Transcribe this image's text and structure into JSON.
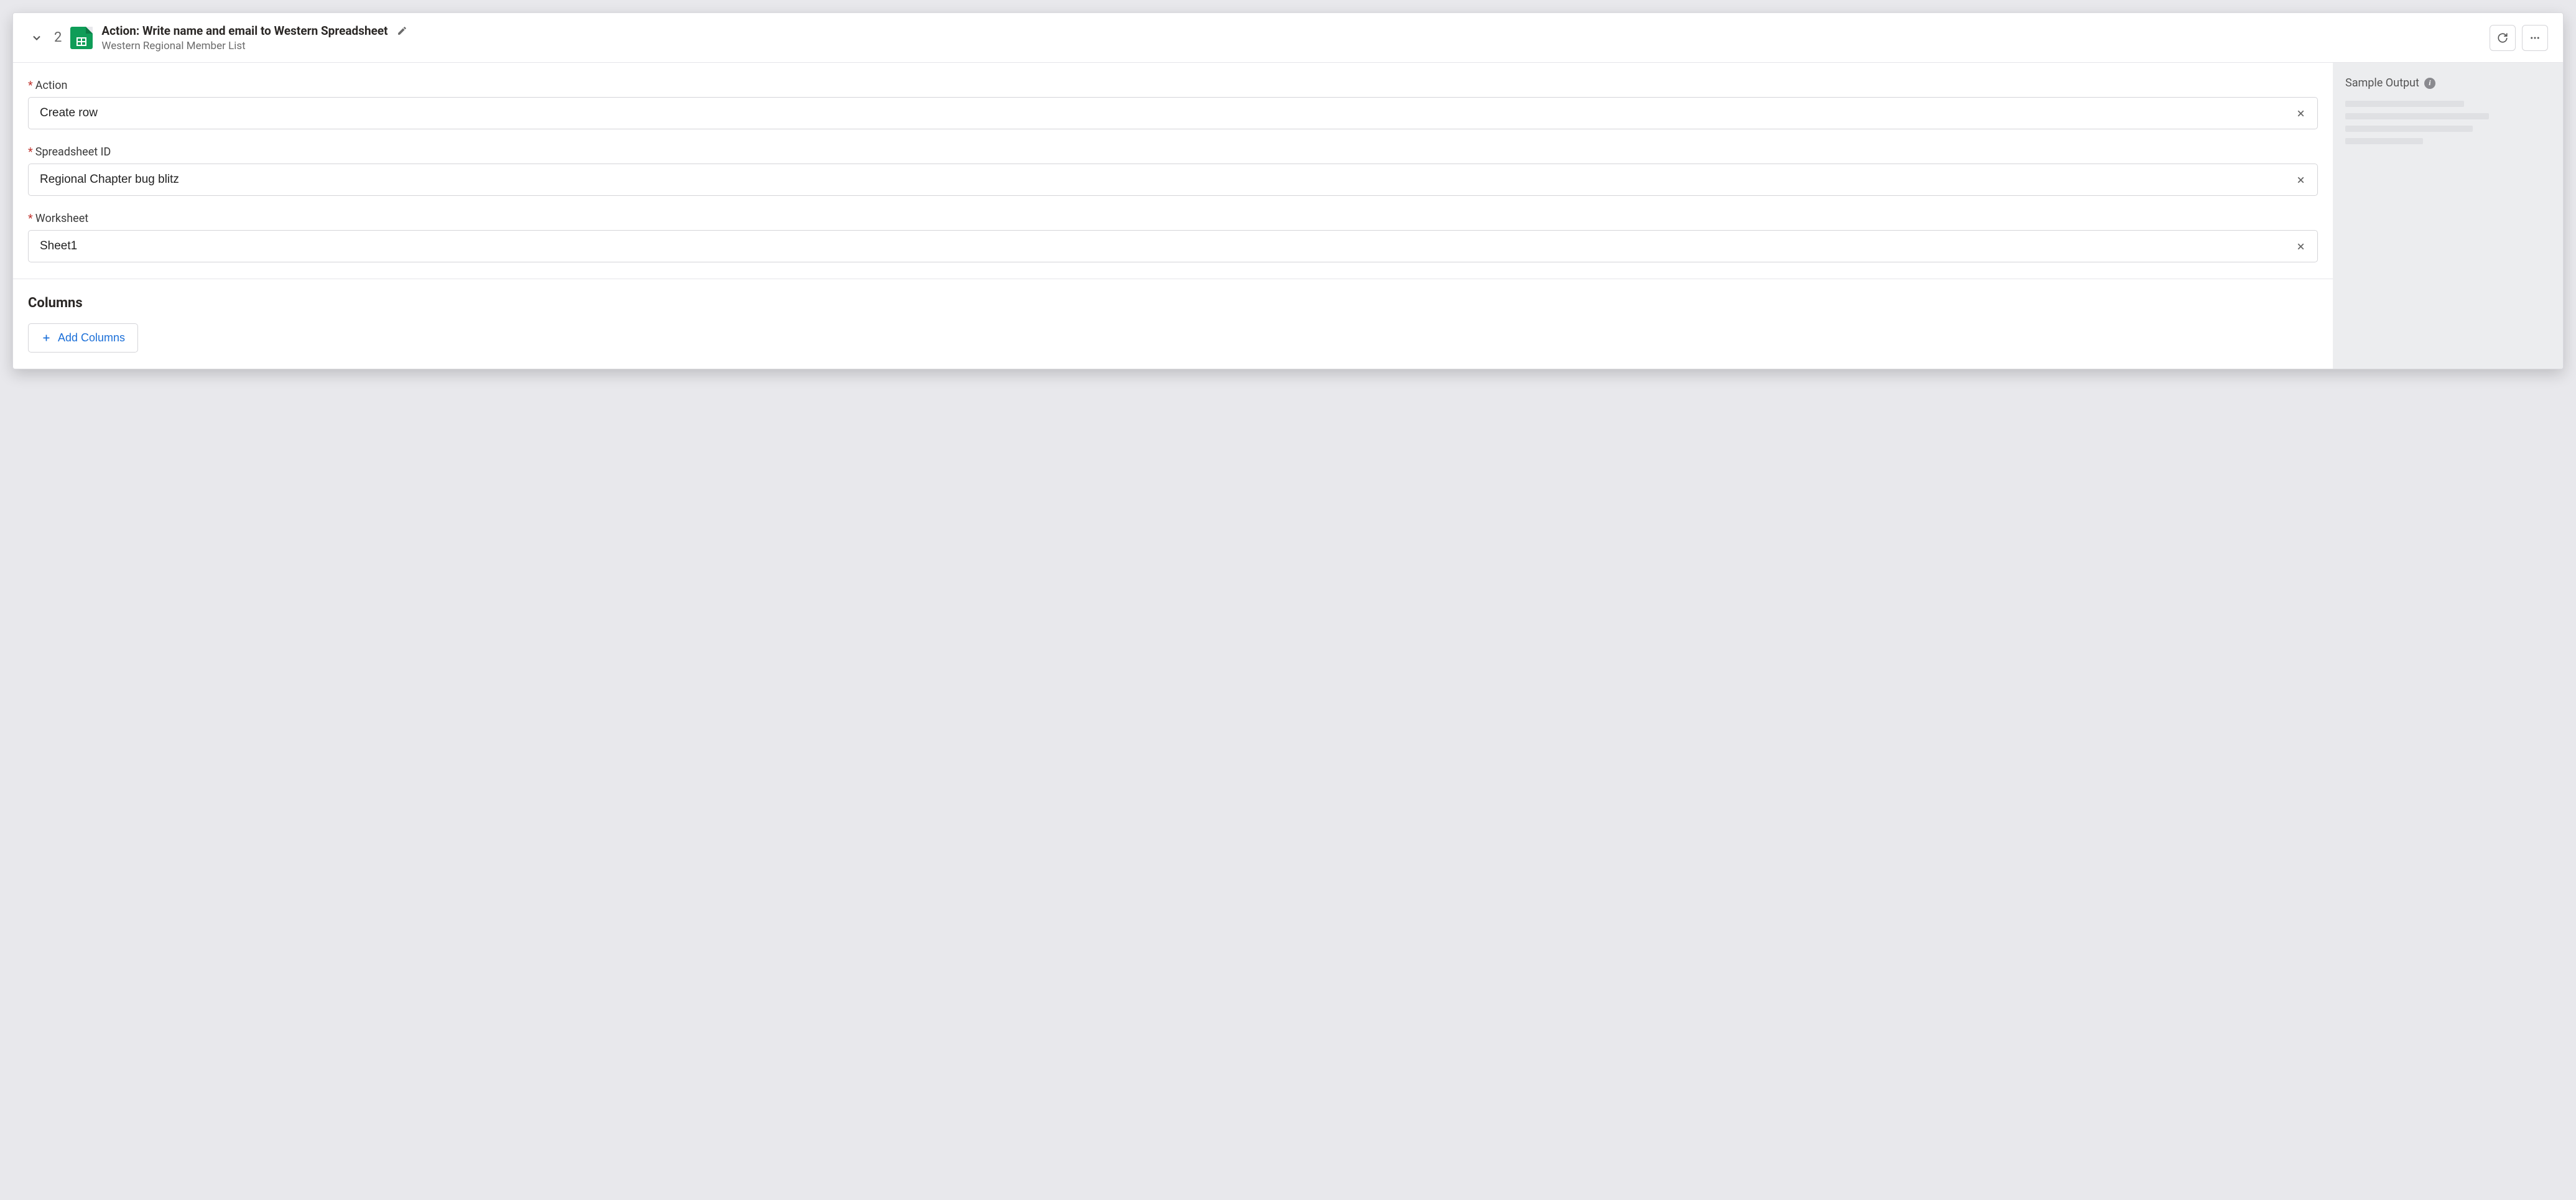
{
  "header": {
    "step_number": "2",
    "title": "Action: Write name and email to Western Spreadsheet",
    "subtitle": "Western Regional Member List",
    "app_icon": "google-sheets"
  },
  "form": {
    "fields": [
      {
        "label": "Action",
        "required": true,
        "value": "Create row"
      },
      {
        "label": "Spreadsheet ID",
        "required": true,
        "value": "Regional Chapter bug blitz"
      },
      {
        "label": "Worksheet",
        "required": true,
        "value": "Sheet1"
      }
    ],
    "columns_section": {
      "heading": "Columns",
      "add_button_label": "Add Columns"
    }
  },
  "side_panel": {
    "heading": "Sample Output"
  }
}
